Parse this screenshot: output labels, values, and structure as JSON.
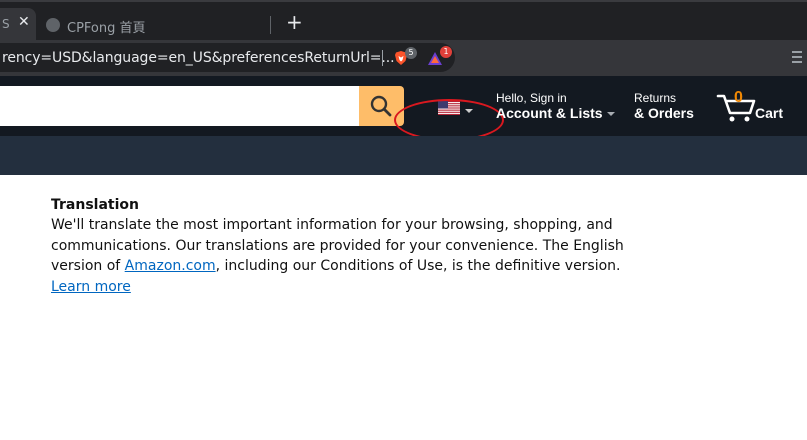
{
  "browser": {
    "active_tab": {
      "title": "S",
      "close": "✕"
    },
    "inactive_tab": {
      "title": "CPFong 首頁"
    },
    "new_tab": "+",
    "url": "rency=USD&language=en_US&preferencesReturnUrl=...",
    "brave_shield_count": "5",
    "rewards_count": "1"
  },
  "amazon_nav": {
    "search": {
      "placeholder": ""
    },
    "locale_flag": "us-flag-icon",
    "account": {
      "line1": "Hello, Sign in",
      "line2": "Account & Lists"
    },
    "returns": {
      "line1": "Returns",
      "line2": "& Orders"
    },
    "cart": {
      "count": "0",
      "label": "Cart"
    }
  },
  "content": {
    "heading": "Translation",
    "paragraph_1": "We'll translate the most important information for your browsing, shopping, and communications. Our translations are provided for your convenience. The English version of ",
    "amazon_link": "Amazon.com",
    "paragraph_2": ", including our Conditions of Use, is the definitive version. ",
    "learn_more": "Learn more"
  },
  "colors": {
    "nav_bg": "#131921",
    "subnav_bg": "#232f3e",
    "search_button": "#febd69",
    "cart_count": "#f08804",
    "link": "#0066c0",
    "highlight": "#d9181f"
  }
}
